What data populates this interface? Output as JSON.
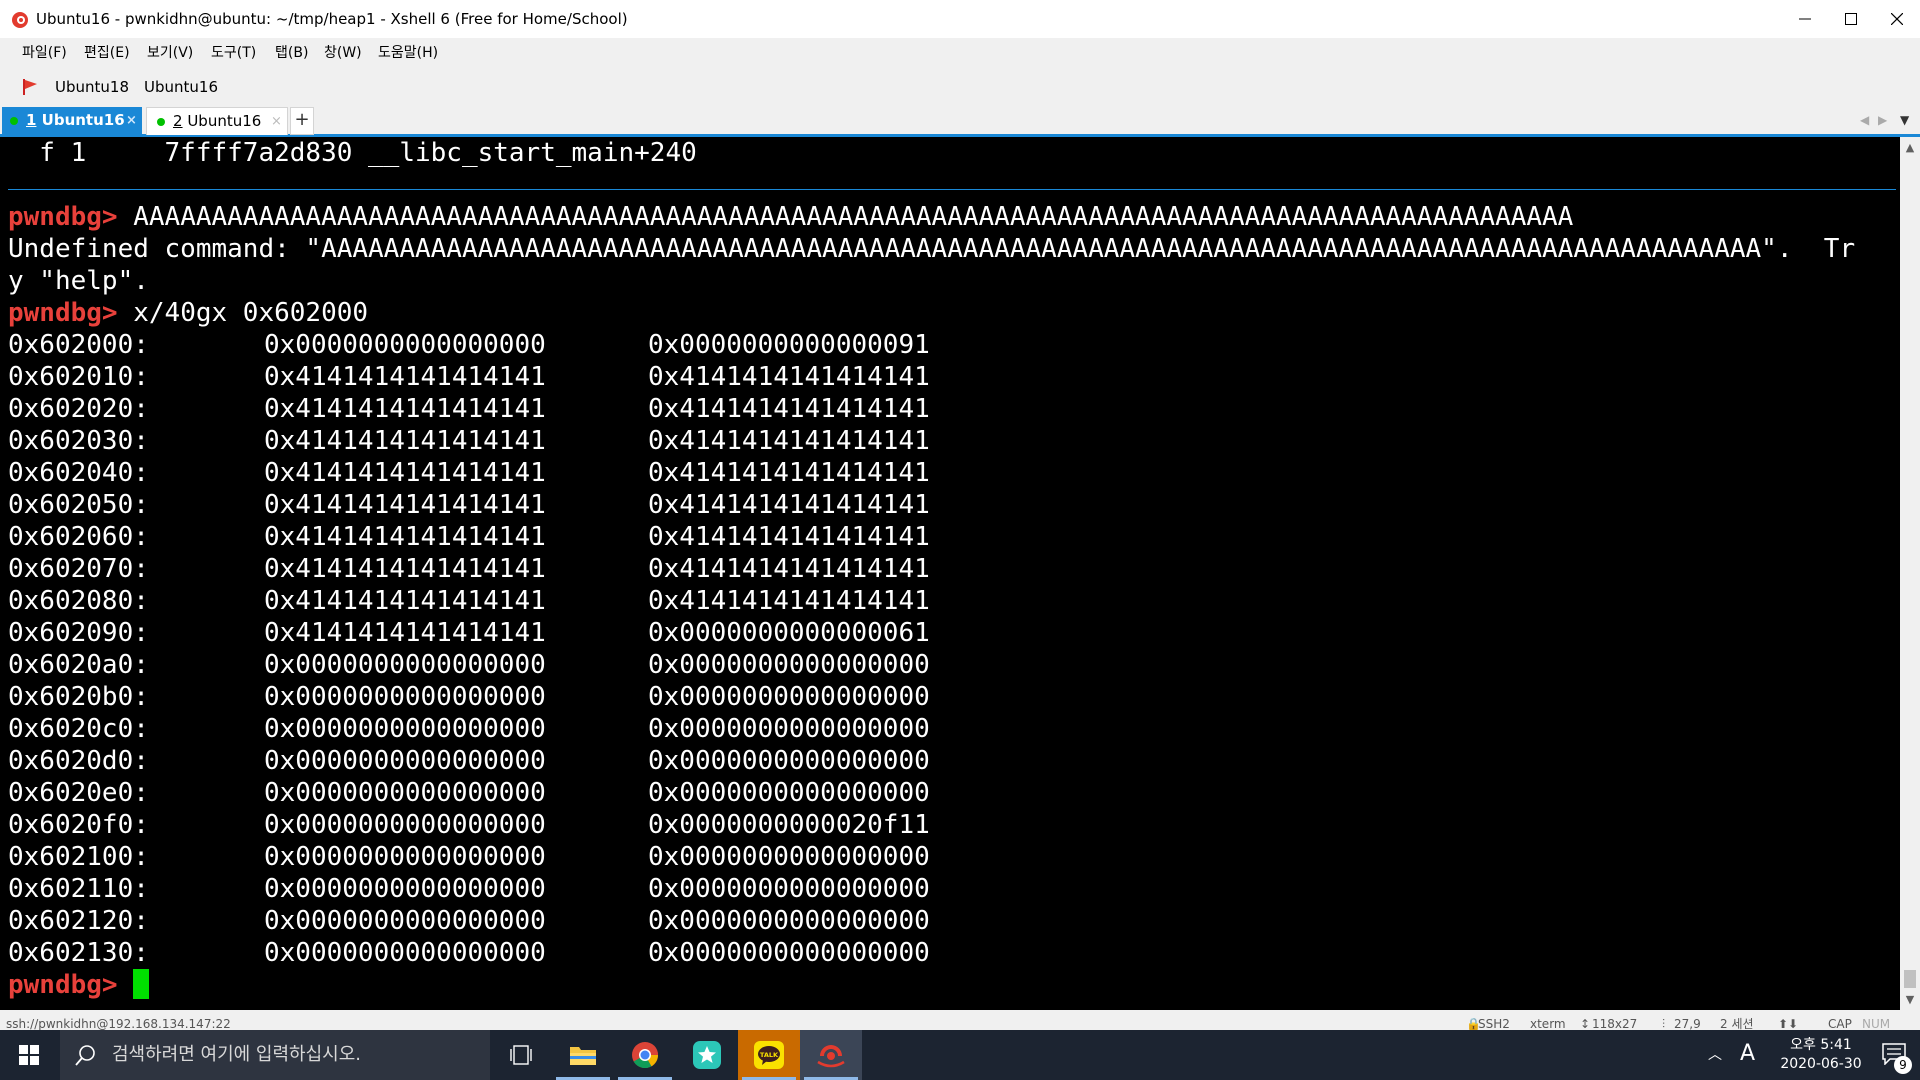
{
  "window": {
    "title": "Ubuntu16 - pwnkidhn@ubuntu: ~/tmp/heap1 - Xshell 6 (Free for Home/School)"
  },
  "menu": [
    "파일(F)",
    "편집(E)",
    "보기(V)",
    "도구(T)",
    "탭(B)",
    "창(W)",
    "도움말(H)"
  ],
  "links": [
    "Ubuntu18",
    "Ubuntu16"
  ],
  "tabs": [
    {
      "num": "1",
      "label": " Ubuntu16",
      "active": true
    },
    {
      "num": "2",
      "label": " Ubuntu16",
      "active": false
    }
  ],
  "tab_add_label": "+",
  "terminal": {
    "frame_line": "  f 1     7ffff7a2d830 __libc_start_main+240",
    "prompt": "pwndbg>",
    "cmd1": " AAAAAAAAAAAAAAAAAAAAAAAAAAAAAAAAAAAAAAAAAAAAAAAAAAAAAAAAAAAAAAAAAAAAAAAAAAAAAAAAAAAAAAAAAAAA",
    "err1": "Undefined command: \"AAAAAAAAAAAAAAAAAAAAAAAAAAAAAAAAAAAAAAAAAAAAAAAAAAAAAAAAAAAAAAAAAAAAAAAAAAAAAAAAAAAAAAAAAAAA\".  Tr",
    "err2": "y \"help\".",
    "cmd2": " x/40gx 0x602000",
    "memory": [
      {
        "addr": "0x602000:",
        "q1": "0x0000000000000000",
        "q2": "0x0000000000000091"
      },
      {
        "addr": "0x602010:",
        "q1": "0x4141414141414141",
        "q2": "0x4141414141414141"
      },
      {
        "addr": "0x602020:",
        "q1": "0x4141414141414141",
        "q2": "0x4141414141414141"
      },
      {
        "addr": "0x602030:",
        "q1": "0x4141414141414141",
        "q2": "0x4141414141414141"
      },
      {
        "addr": "0x602040:",
        "q1": "0x4141414141414141",
        "q2": "0x4141414141414141"
      },
      {
        "addr": "0x602050:",
        "q1": "0x4141414141414141",
        "q2": "0x4141414141414141"
      },
      {
        "addr": "0x602060:",
        "q1": "0x4141414141414141",
        "q2": "0x4141414141414141"
      },
      {
        "addr": "0x602070:",
        "q1": "0x4141414141414141",
        "q2": "0x4141414141414141"
      },
      {
        "addr": "0x602080:",
        "q1": "0x4141414141414141",
        "q2": "0x4141414141414141"
      },
      {
        "addr": "0x602090:",
        "q1": "0x4141414141414141",
        "q2": "0x0000000000000061"
      },
      {
        "addr": "0x6020a0:",
        "q1": "0x0000000000000000",
        "q2": "0x0000000000000000"
      },
      {
        "addr": "0x6020b0:",
        "q1": "0x0000000000000000",
        "q2": "0x0000000000000000"
      },
      {
        "addr": "0x6020c0:",
        "q1": "0x0000000000000000",
        "q2": "0x0000000000000000"
      },
      {
        "addr": "0x6020d0:",
        "q1": "0x0000000000000000",
        "q2": "0x0000000000000000"
      },
      {
        "addr": "0x6020e0:",
        "q1": "0x0000000000000000",
        "q2": "0x0000000000000000"
      },
      {
        "addr": "0x6020f0:",
        "q1": "0x0000000000000000",
        "q2": "0x0000000000020f11"
      },
      {
        "addr": "0x602100:",
        "q1": "0x0000000000000000",
        "q2": "0x0000000000000000"
      },
      {
        "addr": "0x602110:",
        "q1": "0x0000000000000000",
        "q2": "0x0000000000000000"
      },
      {
        "addr": "0x602120:",
        "q1": "0x0000000000000000",
        "q2": "0x0000000000000000"
      },
      {
        "addr": "0x602130:",
        "q1": "0x0000000000000000",
        "q2": "0x0000000000000000"
      }
    ]
  },
  "statusbar": {
    "connection": "ssh://pwnkidhn@192.168.134.147:22",
    "protocol": "SSH2",
    "term": "xterm",
    "size": "118x27",
    "position": "27,9",
    "sessions": "2 세션",
    "cap": "CAP",
    "num": "NUM"
  },
  "taskbar": {
    "search_placeholder": "검색하려면 여기에 입력하십시오.",
    "clock_ampm_time": "오후 5:41",
    "clock_date": "2020-06-30",
    "ime": "A",
    "notification_count": "9",
    "kakao_label": "TALK"
  },
  "colors": {
    "prompt": "#e8413b",
    "tab_active": "#1a88d6",
    "cursor": "#00e000",
    "taskbar": "#1c2431"
  }
}
